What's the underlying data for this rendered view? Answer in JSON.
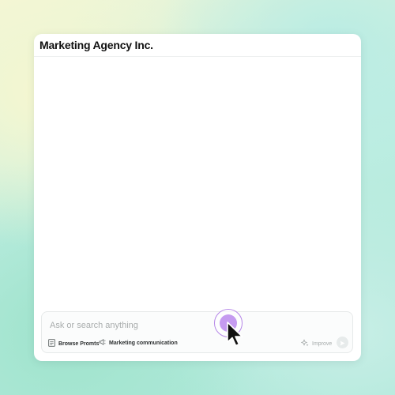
{
  "window": {
    "title": "Marketing Agency Inc."
  },
  "composer": {
    "placeholder": "Ask or search anything",
    "value": "",
    "browse_label": "Browse Promts",
    "communication_label": "Marketing communication",
    "improve_label": "Improve"
  },
  "icons": {
    "browse": "document-icon",
    "communication": "megaphone-icon",
    "improve": "sparkle-icon",
    "send": "send-icon",
    "record": "record-icon",
    "cursor": "mouse-pointer-icon"
  },
  "colors": {
    "accent_purple": "#c59bf0",
    "accent_ring": "#b687e8",
    "background_mint": "#a9e7d6",
    "background_yellow": "#f3f6d6"
  }
}
